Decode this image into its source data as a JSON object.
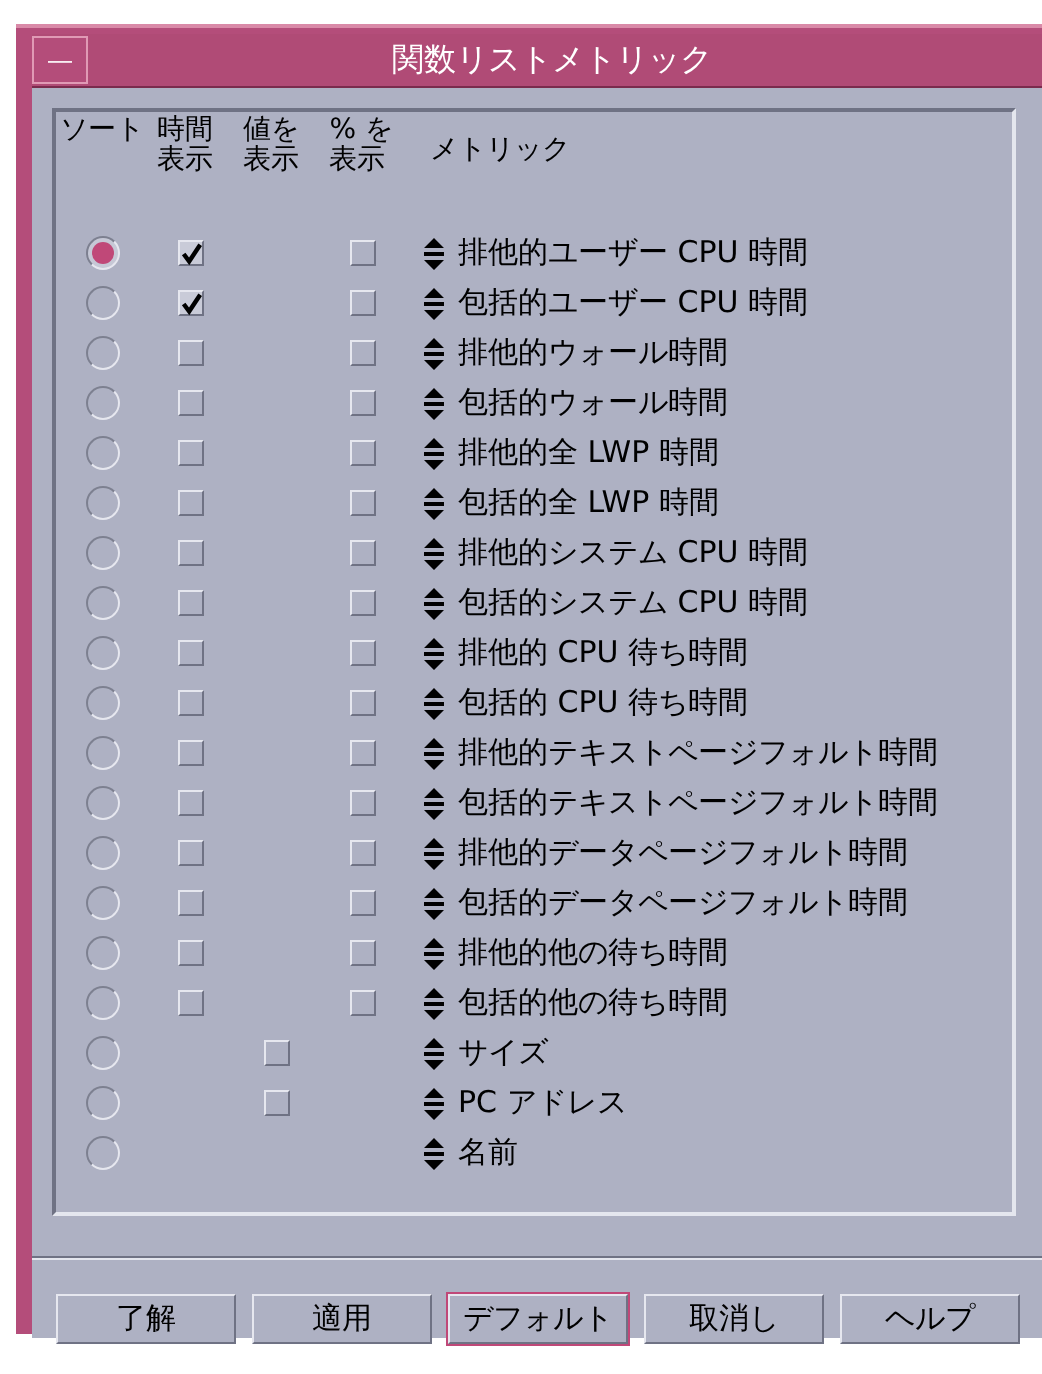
{
  "window": {
    "title": "関数リストメトリック",
    "menu_glyph": "—"
  },
  "columns": [
    "ソート",
    "時間表示",
    "値を表示",
    "% を表示",
    "メトリック"
  ],
  "rows": [
    {
      "name": "排他的ユーザー CPU 時間",
      "selected": true,
      "time": {
        "checked": true
      },
      "percent": {
        "checked": false
      }
    },
    {
      "name": "包括的ユーザー CPU 時間",
      "selected": false,
      "time": {
        "checked": true
      },
      "percent": {
        "checked": false
      }
    },
    {
      "name": "排他的ウォール時間",
      "selected": false,
      "time": {
        "checked": false
      },
      "percent": {
        "checked": false
      }
    },
    {
      "name": "包括的ウォール時間",
      "selected": false,
      "time": {
        "checked": false
      },
      "percent": {
        "checked": false
      }
    },
    {
      "name": "排他的全 LWP 時間",
      "selected": false,
      "time": {
        "checked": false
      },
      "percent": {
        "checked": false
      }
    },
    {
      "name": "包括的全 LWP 時間",
      "selected": false,
      "time": {
        "checked": false
      },
      "percent": {
        "checked": false
      }
    },
    {
      "name": "排他的システム CPU 時間",
      "selected": false,
      "time": {
        "checked": false
      },
      "percent": {
        "checked": false
      }
    },
    {
      "name": "包括的システム CPU 時間",
      "selected": false,
      "time": {
        "checked": false
      },
      "percent": {
        "checked": false
      }
    },
    {
      "name": "排他的 CPU 待ち時間",
      "selected": false,
      "time": {
        "checked": false
      },
      "percent": {
        "checked": false
      }
    },
    {
      "name": "包括的 CPU 待ち時間",
      "selected": false,
      "time": {
        "checked": false
      },
      "percent": {
        "checked": false
      }
    },
    {
      "name": "排他的テキストページフォルト時間",
      "selected": false,
      "time": {
        "checked": false
      },
      "percent": {
        "checked": false
      }
    },
    {
      "name": "包括的テキストページフォルト時間",
      "selected": false,
      "time": {
        "checked": false
      },
      "percent": {
        "checked": false
      }
    },
    {
      "name": "排他的データページフォルト時間",
      "selected": false,
      "time": {
        "checked": false
      },
      "percent": {
        "checked": false
      }
    },
    {
      "name": "包括的データページフォルト時間",
      "selected": false,
      "time": {
        "checked": false
      },
      "percent": {
        "checked": false
      }
    },
    {
      "name": "排他的他の待ち時間",
      "selected": false,
      "time": {
        "checked": false
      },
      "percent": {
        "checked": false
      }
    },
    {
      "name": "包括的他の待ち時間",
      "selected": false,
      "time": {
        "checked": false
      },
      "percent": {
        "checked": false
      }
    },
    {
      "name": "サイズ",
      "selected": false,
      "value": {
        "checked": false
      }
    },
    {
      "name": "PC アドレス",
      "selected": false,
      "value": {
        "checked": false
      }
    },
    {
      "name": "名前",
      "selected": false
    }
  ],
  "buttons": [
    {
      "label": "了解",
      "focused": false
    },
    {
      "label": "適用",
      "focused": false
    },
    {
      "label": "デフォルト",
      "focused": true
    },
    {
      "label": "取消し",
      "focused": false
    },
    {
      "label": "ヘルプ",
      "focused": false
    }
  ]
}
